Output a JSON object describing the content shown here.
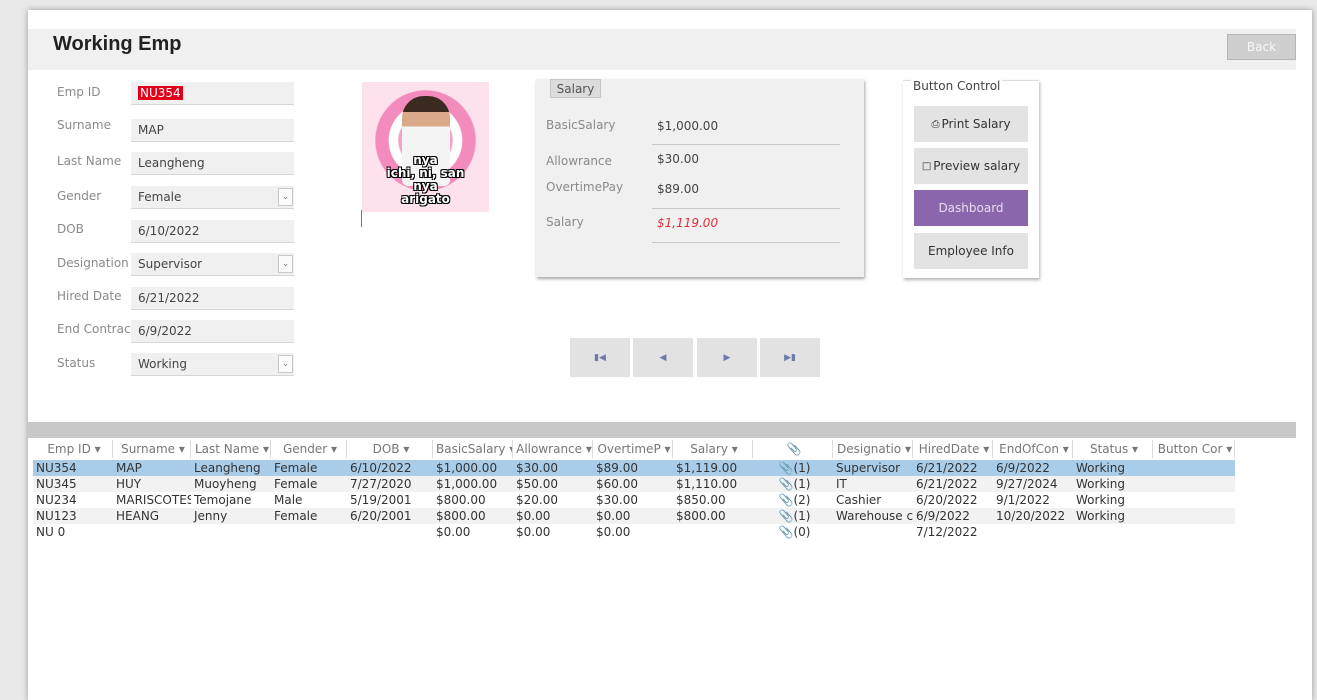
{
  "title": "Working Emp",
  "back_label": "Back",
  "form": {
    "emp_id_label": "Emp ID",
    "emp_id": "NU354",
    "surname_label": "Surname",
    "surname": "MAP",
    "lastname_label": "Last Name",
    "lastname": "Leangheng",
    "gender_label": "Gender",
    "gender": "Female",
    "dob_label": "DOB",
    "dob": "6/10/2022",
    "designation_label": "Designation",
    "designation": "Supervisor",
    "hired_label": "Hired Date",
    "hired": "6/21/2022",
    "end_label": "End Contract",
    "end": "6/9/2022",
    "status_label": "Status",
    "status": "Working"
  },
  "photo_caption": [
    "nya",
    "ichi, ni, san",
    "nya",
    "arigato"
  ],
  "salary": {
    "tab": "Salary",
    "basic_label": "BasicSalary",
    "basic": "$1,000.00",
    "allowance_label": "Allowrance",
    "allowance": "$30.00",
    "overtime_label": "OvertimePay",
    "overtime": "$89.00",
    "salary_label": "Salary",
    "salary": "$1,119.00",
    "salary_color": "#e0313a"
  },
  "buttons": {
    "title": "Button Control",
    "print": "Print Salary",
    "preview": "Preview salary",
    "dashboard": "Dashboard",
    "employee_info": "Employee Info",
    "dashboard_color": "#8c66ad"
  },
  "nav": {
    "first_icon": "first-record-icon",
    "prev_icon": "previous-record-icon",
    "next_icon": "next-record-icon",
    "last_icon": "last-record-icon"
  },
  "grid": {
    "headers": [
      "Emp ID",
      "Surname",
      "Last Name",
      "Gender",
      "DOB",
      "BasicSalary",
      "Allowrance",
      "OvertimeP",
      "Salary",
      "",
      "Designatio",
      "HiredDate",
      "EndOfCon",
      "Status",
      "Button Cor"
    ],
    "rows": [
      [
        "NU354",
        "MAP",
        "Leangheng",
        "Female",
        "6/10/2022",
        "$1,000.00",
        "$30.00",
        "$89.00",
        "$1,119.00",
        "(1)",
        "Supervisor",
        "6/21/2022",
        "6/9/2022",
        "Working",
        ""
      ],
      [
        "NU345",
        "HUY",
        "Muoyheng",
        "Female",
        "7/27/2020",
        "$1,000.00",
        "$50.00",
        "$60.00",
        "$1,110.00",
        "(1)",
        "IT",
        "6/21/2022",
        "9/27/2024",
        "Working",
        ""
      ],
      [
        "NU234",
        "MARISCOTES",
        "Temojane",
        "Male",
        "5/19/2001",
        "$800.00",
        "$20.00",
        "$30.00",
        "$850.00",
        "(2)",
        "Cashier",
        "6/20/2022",
        "9/1/2022",
        "Working",
        ""
      ],
      [
        "NU123",
        "HEANG",
        "Jenny",
        "Female",
        "6/20/2001",
        "$800.00",
        "$0.00",
        "$0.00",
        "$800.00",
        "(1)",
        "Warehouse c",
        "6/9/2022",
        "10/20/2022",
        "Working",
        ""
      ],
      [
        "NU 0",
        "",
        "",
        "",
        "",
        "$0.00",
        "$0.00",
        "$0.00",
        "",
        "(0)",
        "",
        "7/12/2022",
        "",
        "",
        ""
      ]
    ]
  }
}
